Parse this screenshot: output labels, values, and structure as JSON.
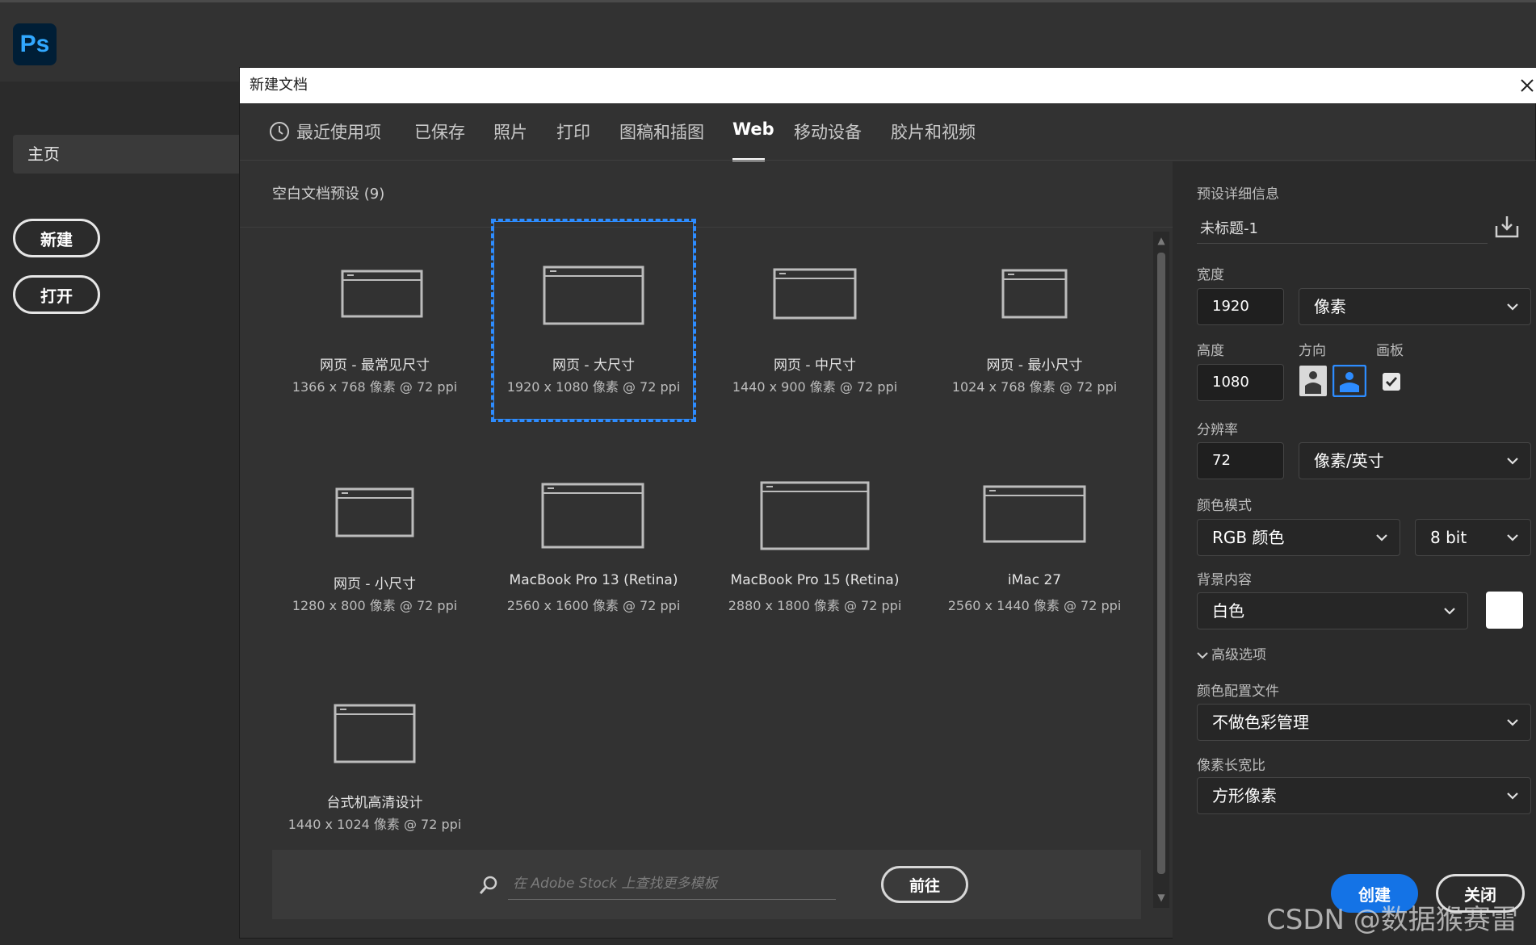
{
  "app": {
    "logo_text": "Ps",
    "home_item": "主页",
    "new_button": "新建",
    "open_button": "打开"
  },
  "dialog": {
    "title": "新建文档",
    "tabs": [
      {
        "label": "最近使用项",
        "active": false
      },
      {
        "label": "已保存",
        "active": false
      },
      {
        "label": "照片",
        "active": false
      },
      {
        "label": "打印",
        "active": false
      },
      {
        "label": "图稿和插图",
        "active": false
      },
      {
        "label": "Web",
        "active": true
      },
      {
        "label": "移动设备",
        "active": false
      },
      {
        "label": "胶片和视频",
        "active": false
      }
    ],
    "section_title": "空白文档预设 (9)",
    "presets": [
      {
        "name": "网页 - 最常见尺寸",
        "size": "1366 x 768 像素 @ 72 ppi",
        "selected": false
      },
      {
        "name": "网页 - 大尺寸",
        "size": "1920 x 1080 像素 @ 72 ppi",
        "selected": true
      },
      {
        "name": "网页 - 中尺寸",
        "size": "1440 x 900 像素 @ 72 ppi",
        "selected": false
      },
      {
        "name": "网页 - 最小尺寸",
        "size": "1024 x 768 像素 @ 72 ppi",
        "selected": false
      },
      {
        "name": "网页 - 小尺寸",
        "size": "1280 x 800 像素 @ 72 ppi",
        "selected": false
      },
      {
        "name": "MacBook Pro 13 (Retina)",
        "size": "2560 x 1600 像素 @ 72 ppi",
        "selected": false
      },
      {
        "name": "MacBook Pro 15 (Retina)",
        "size": "2880 x 1800 像素 @ 72 ppi",
        "selected": false
      },
      {
        "name": "iMac 27",
        "size": "2560 x 1440 像素 @ 72 ppi",
        "selected": false
      },
      {
        "name": "台式机高清设计",
        "size": "1440 x 1024 像素 @ 72 ppi",
        "selected": false
      }
    ],
    "stock_search": {
      "placeholder": "在 Adobe Stock 上查找更多模板",
      "go_button": "前往"
    },
    "details": {
      "heading": "预设详细信息",
      "doc_name": "未标题-1",
      "width_label": "宽度",
      "width_value": "1920",
      "width_unit": "像素",
      "height_label": "高度",
      "height_value": "1080",
      "orientation_label": "方向",
      "orientation_selected": "landscape",
      "artboard_label": "画板",
      "artboard_checked": true,
      "resolution_label": "分辨率",
      "resolution_value": "72",
      "resolution_unit": "像素/英寸",
      "color_mode_label": "颜色模式",
      "color_mode_value": "RGB 颜色",
      "bit_depth_value": "8 bit",
      "background_label": "背景内容",
      "background_value": "白色",
      "background_swatch": "#ffffff",
      "advanced_label": "高级选项",
      "color_profile_label": "颜色配置文件",
      "color_profile_value": "不做色彩管理",
      "pixel_aspect_label": "像素长宽比",
      "pixel_aspect_value": "方形像素"
    },
    "create_button": "创建",
    "close_button": "关闭"
  },
  "colors": {
    "accent": "#1473e6",
    "selection": "#2d8cff",
    "ps_logo_bg": "#001e36",
    "ps_logo_text": "#31a8ff"
  },
  "watermark": "CSDN @数据猴赛雷"
}
